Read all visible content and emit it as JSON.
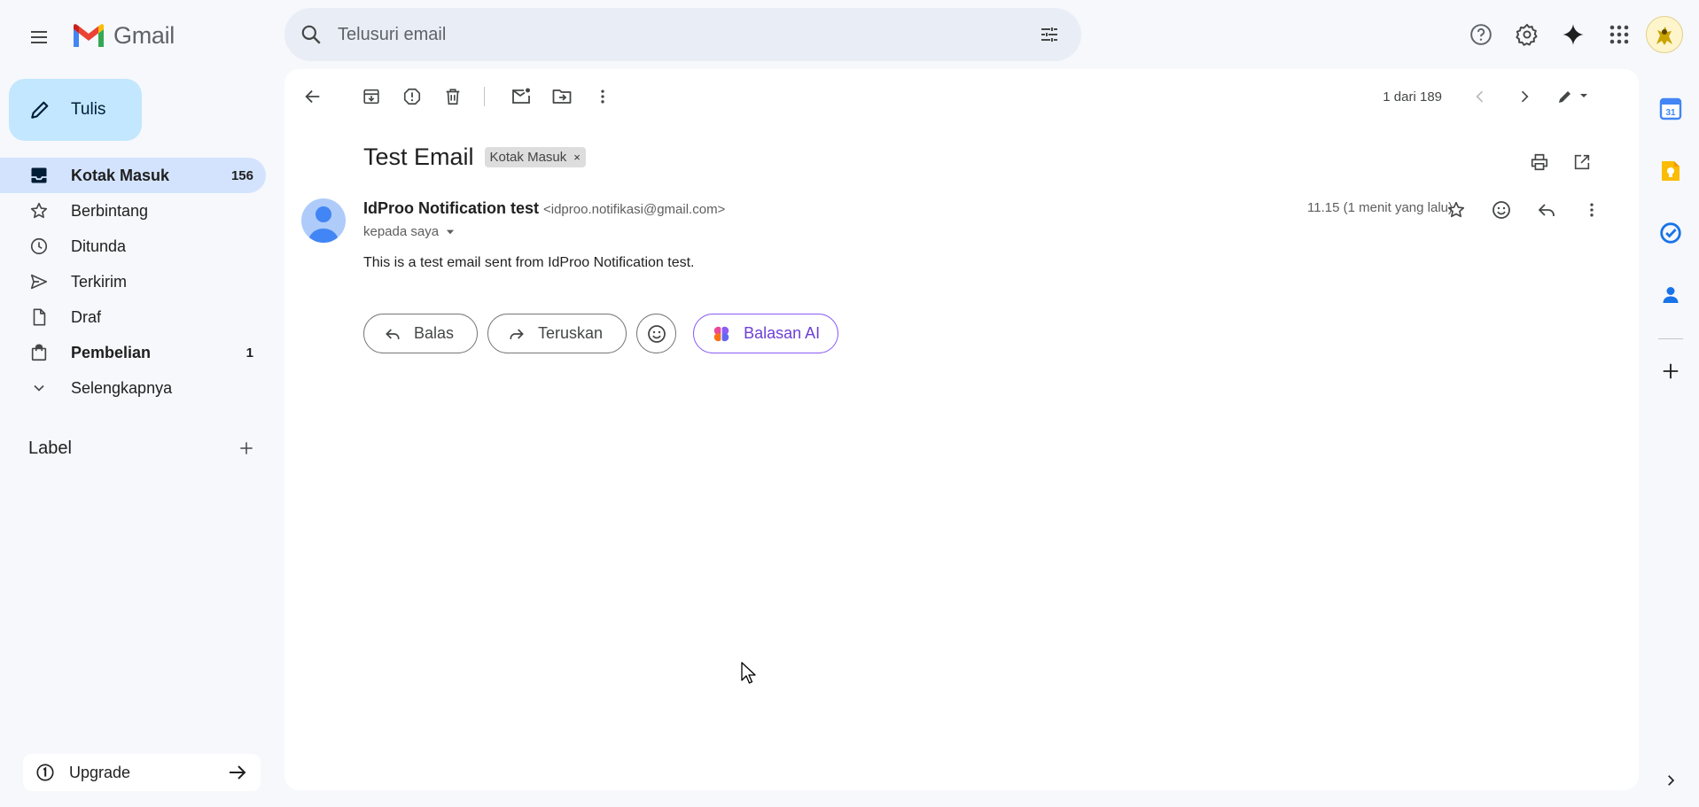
{
  "app": {
    "name": "Gmail"
  },
  "search": {
    "placeholder": "Telusuri email"
  },
  "compose": {
    "label": "Tulis"
  },
  "nav": [
    {
      "label": "Kotak Masuk",
      "count": "156",
      "icon": "inbox-icon",
      "active": true,
      "bold": true
    },
    {
      "label": "Berbintang",
      "count": "",
      "icon": "star-icon"
    },
    {
      "label": "Ditunda",
      "count": "",
      "icon": "clock-icon"
    },
    {
      "label": "Terkirim",
      "count": "",
      "icon": "send-icon"
    },
    {
      "label": "Draf",
      "count": "",
      "icon": "draft-icon"
    },
    {
      "label": "Pembelian",
      "count": "1",
      "icon": "shopping-bag-icon",
      "bold": true
    },
    {
      "label": "Selengkapnya",
      "count": "",
      "icon": "chevron-down-icon"
    }
  ],
  "labels": {
    "title": "Label"
  },
  "upgrade": {
    "label": "Upgrade"
  },
  "pager": {
    "text": "1 dari 189"
  },
  "email": {
    "subject": "Test Email",
    "label_chip": "Kotak Masuk",
    "chip_close": "×",
    "sender_name": "IdProo Notification test",
    "sender_email": "<idproo.notifikasi@gmail.com>",
    "to": "kepada saya",
    "time": "11.15 (1 menit yang lalu)",
    "body": "This is a test email sent from IdProo Notification test."
  },
  "replies": {
    "reply": "Balas",
    "forward": "Teruskan",
    "ai": "Balasan AI"
  },
  "side_panel": {
    "calendar_day": "31"
  },
  "colors": {
    "accent": "#0b57d0",
    "compose_bg": "#c2e7ff",
    "active_nav": "#d3e3fd",
    "ai": "#6d3fd6"
  }
}
